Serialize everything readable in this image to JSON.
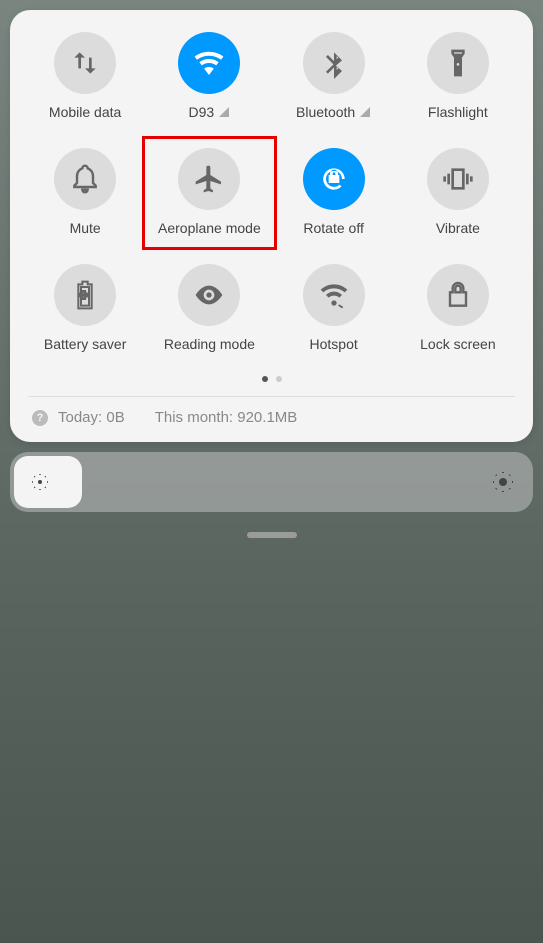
{
  "tiles": [
    {
      "id": "mobile-data",
      "label": "Mobile data",
      "active": false,
      "icon": "arrows",
      "signal": true
    },
    {
      "id": "wifi",
      "label": "D93",
      "active": true,
      "icon": "wifi",
      "signal": true
    },
    {
      "id": "bluetooth",
      "label": "Bluetooth",
      "active": false,
      "icon": "bluetooth",
      "signal": true
    },
    {
      "id": "flashlight",
      "label": "Flashlight",
      "active": false,
      "icon": "flashlight"
    },
    {
      "id": "mute",
      "label": "Mute",
      "active": false,
      "icon": "bell"
    },
    {
      "id": "aeroplane",
      "label": "Aeroplane mode",
      "active": false,
      "icon": "plane",
      "highlighted": true
    },
    {
      "id": "rotate",
      "label": "Rotate off",
      "active": true,
      "icon": "rotate"
    },
    {
      "id": "vibrate",
      "label": "Vibrate",
      "active": false,
      "icon": "vibrate"
    },
    {
      "id": "battery",
      "label": "Battery saver",
      "active": false,
      "icon": "battery"
    },
    {
      "id": "reading",
      "label": "Reading mode",
      "active": false,
      "icon": "eye"
    },
    {
      "id": "hotspot",
      "label": "Hotspot",
      "active": false,
      "icon": "hotspot"
    },
    {
      "id": "lock",
      "label": "Lock screen",
      "active": false,
      "icon": "lock"
    }
  ],
  "data_usage": {
    "today_label": "Today: 0B",
    "month_label": "This month: 920.1MB"
  },
  "pages": {
    "current": 0,
    "total": 2
  }
}
